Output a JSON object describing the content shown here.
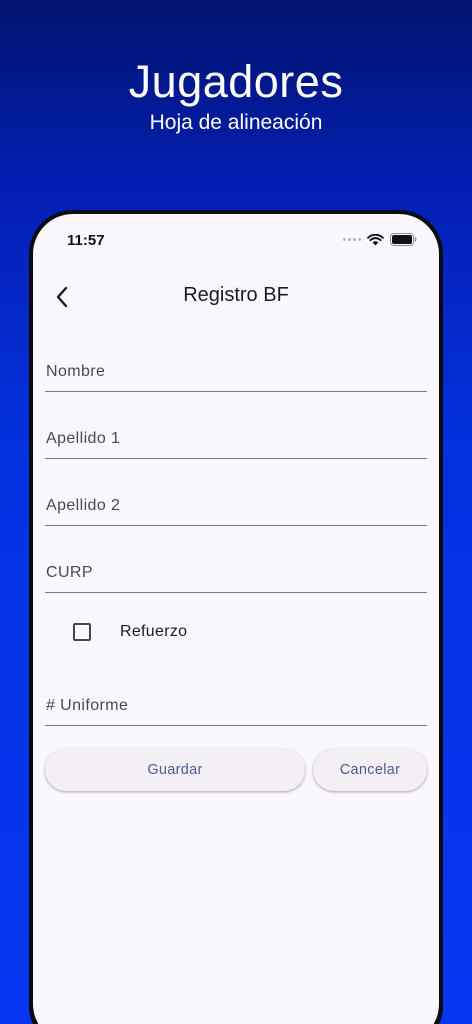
{
  "promo": {
    "title": "Jugadores",
    "subtitle": "Hoja de alineación"
  },
  "status_bar": {
    "time": "11:57",
    "icons": [
      "cellular-signal-icon",
      "wifi-icon",
      "battery-icon"
    ]
  },
  "app_bar": {
    "back_icon": "chevron-left-icon",
    "title": "Registro BF"
  },
  "form": {
    "nombre": {
      "placeholder": "Nombre",
      "value": ""
    },
    "apellido1": {
      "placeholder": "Apellido 1",
      "value": ""
    },
    "apellido2": {
      "placeholder": "Apellido 2",
      "value": ""
    },
    "curp": {
      "placeholder": "CURP",
      "value": ""
    },
    "refuerzo": {
      "label": "Refuerzo",
      "checked": false
    },
    "uniforme": {
      "placeholder": "# Uniforme",
      "value": ""
    }
  },
  "buttons": {
    "save_label": "Guardar",
    "cancel_label": "Cancelar"
  },
  "colors": {
    "background_top": "#02136e",
    "background_bottom": "#0636f2",
    "screen": "#fbf8fd",
    "button_bg": "#f3eff5",
    "button_text": "#4c5b92"
  }
}
